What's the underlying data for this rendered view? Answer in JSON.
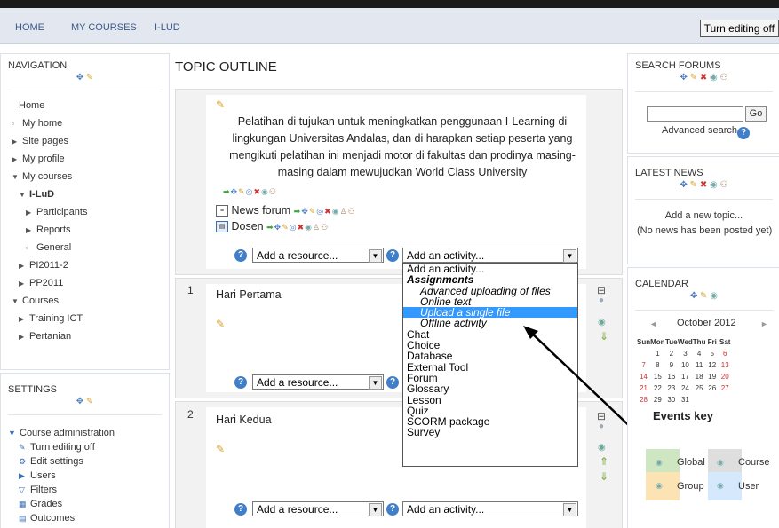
{
  "header": {
    "crumbs": [
      "HOME",
      "MY COURSES",
      "I-LUD"
    ],
    "editing_button": "Turn editing off"
  },
  "navigation": {
    "title": "NAVIGATION",
    "items": [
      {
        "label": "Home",
        "marker": ""
      },
      {
        "label": "My home",
        "marker": "▫"
      },
      {
        "label": "Site pages",
        "marker": "▶"
      },
      {
        "label": "My profile",
        "marker": "▶"
      },
      {
        "label": "My courses",
        "marker": "▼"
      },
      {
        "label": "I-LuD",
        "marker": "▼"
      },
      {
        "label": "Participants",
        "marker": "▶"
      },
      {
        "label": "Reports",
        "marker": "▶"
      },
      {
        "label": "General",
        "marker": "▫"
      },
      {
        "label": "PI2011-2",
        "marker": "▶"
      },
      {
        "label": "PP2011",
        "marker": "▶"
      },
      {
        "label": "Courses",
        "marker": "▼"
      },
      {
        "label": "Training ICT",
        "marker": "▶"
      },
      {
        "label": "Pertanian",
        "marker": "▶"
      }
    ]
  },
  "settings": {
    "title": "SETTINGS",
    "items": [
      {
        "label": "Course administration",
        "marker": "▼"
      },
      {
        "label": "Turn editing off",
        "marker": "✎"
      },
      {
        "label": "Edit settings",
        "marker": "⚙"
      },
      {
        "label": "Users",
        "marker": "▶"
      },
      {
        "label": "Filters",
        "marker": "▽"
      },
      {
        "label": "Grades",
        "marker": "▦"
      },
      {
        "label": "Outcomes",
        "marker": "▤"
      }
    ]
  },
  "main": {
    "title": "TOPIC OUTLINE",
    "summary": "Pelatihan di tujukan untuk meningkatkan penggunaan I-Learning di lingkungan Universitas Andalas, dan di harapkan setiap peserta yang mengikuti pelatihan ini menjadi motor di fakultas dan prodinya masing-masing dalam mewujudkan World Class University",
    "activities": [
      {
        "label": "News forum",
        "icon": "forum-icon"
      },
      {
        "label": "Dosen",
        "icon": "resource-icon"
      }
    ],
    "sections": [
      {
        "number": "1",
        "title": "Hari Pertama"
      },
      {
        "number": "2",
        "title": "Hari Kedua"
      }
    ],
    "add_resource": "Add a resource...",
    "add_activity": "Add an activity..."
  },
  "activity_menu": {
    "items": [
      {
        "label": "Add an activity...",
        "kind": "plain"
      },
      {
        "label": "Assignments",
        "kind": "group"
      },
      {
        "label": "Advanced uploading of files",
        "kind": "sub"
      },
      {
        "label": "Online text",
        "kind": "sub"
      },
      {
        "label": "Upload a single file",
        "kind": "sub-selected"
      },
      {
        "label": "Offline activity",
        "kind": "sub"
      },
      {
        "label": "Chat",
        "kind": "plain"
      },
      {
        "label": "Choice",
        "kind": "plain"
      },
      {
        "label": "Database",
        "kind": "plain"
      },
      {
        "label": "External Tool",
        "kind": "plain"
      },
      {
        "label": "Forum",
        "kind": "plain"
      },
      {
        "label": "Glossary",
        "kind": "plain"
      },
      {
        "label": "Lesson",
        "kind": "plain"
      },
      {
        "label": "Quiz",
        "kind": "plain"
      },
      {
        "label": "SCORM package",
        "kind": "plain"
      },
      {
        "label": "Survey",
        "kind": "plain"
      }
    ]
  },
  "search_forums": {
    "title": "SEARCH FORUMS",
    "go": "Go",
    "advanced": "Advanced search"
  },
  "latest_news": {
    "title": "LATEST NEWS",
    "add": "Add a new topic...",
    "empty": "(No news has been posted yet)"
  },
  "calendar": {
    "title": "CALENDAR",
    "month": "October 2012",
    "prev": "◄",
    "next": "►",
    "days": [
      "Sun",
      "Mon",
      "Tue",
      "Wed",
      "Thu",
      "Fri",
      "Sat"
    ],
    "weeks": [
      [
        "",
        "1",
        "2",
        "3",
        "4",
        "5",
        "6"
      ],
      [
        "7",
        "8",
        "9",
        "10",
        "11",
        "12",
        "13"
      ],
      [
        "14",
        "15",
        "16",
        "17",
        "18",
        "19",
        "20"
      ],
      [
        "21",
        "22",
        "23",
        "24",
        "25",
        "26",
        "27"
      ],
      [
        "28",
        "29",
        "30",
        "31",
        "",
        "",
        ""
      ]
    ],
    "events_key": "Events key",
    "keys": [
      {
        "label": "Global",
        "color": "#cfe6c3"
      },
      {
        "label": "Course",
        "color": "#dedede"
      },
      {
        "label": "Group",
        "color": "#fbe3b3"
      },
      {
        "label": "User",
        "color": "#d6e8fb"
      }
    ]
  },
  "colors": {
    "nav_bg": "#e3e8f0",
    "selected": "#3399ff",
    "link": "#3a5a8a"
  }
}
